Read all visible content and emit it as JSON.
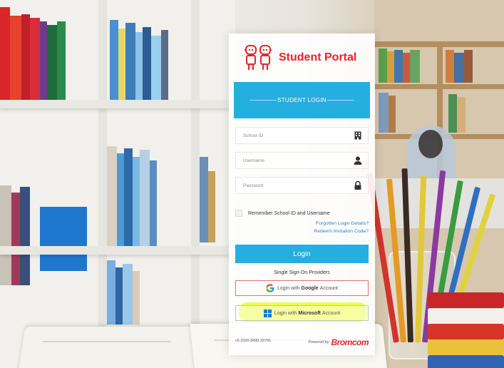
{
  "brand": {
    "title": "Student Portal",
    "logo_icon": "two-students-icon",
    "accent": "#e3262b"
  },
  "login_tab": {
    "label": "STUDENT LOGIN",
    "color": "#25aee0"
  },
  "fields": {
    "school_id": {
      "placeholder": "School ID",
      "icon": "building-icon"
    },
    "username": {
      "placeholder": "Username",
      "icon": "user-icon"
    },
    "password": {
      "placeholder": "Password",
      "icon": "lock-icon"
    }
  },
  "remember": {
    "label": "Remember School ID and Username",
    "checked": false
  },
  "links": {
    "forgotten": "Forgotten Login Details?",
    "redeem": "Redeem Invitation Code?"
  },
  "login_button": {
    "label": "Login"
  },
  "sso": {
    "heading": "Single Sign-On Providers",
    "google": {
      "prefix": "Login with",
      "provider": "Google",
      "suffix": "Account",
      "icon": "google-icon"
    },
    "microsoft": {
      "prefix": "Login with",
      "provider": "Microsoft",
      "suffix": "Account",
      "icon": "windows-icon",
      "highlighted": true
    }
  },
  "footer": {
    "version": "v5.2020.8490.33791",
    "powered_by": "Powered by",
    "vendor": "Bromcom"
  }
}
